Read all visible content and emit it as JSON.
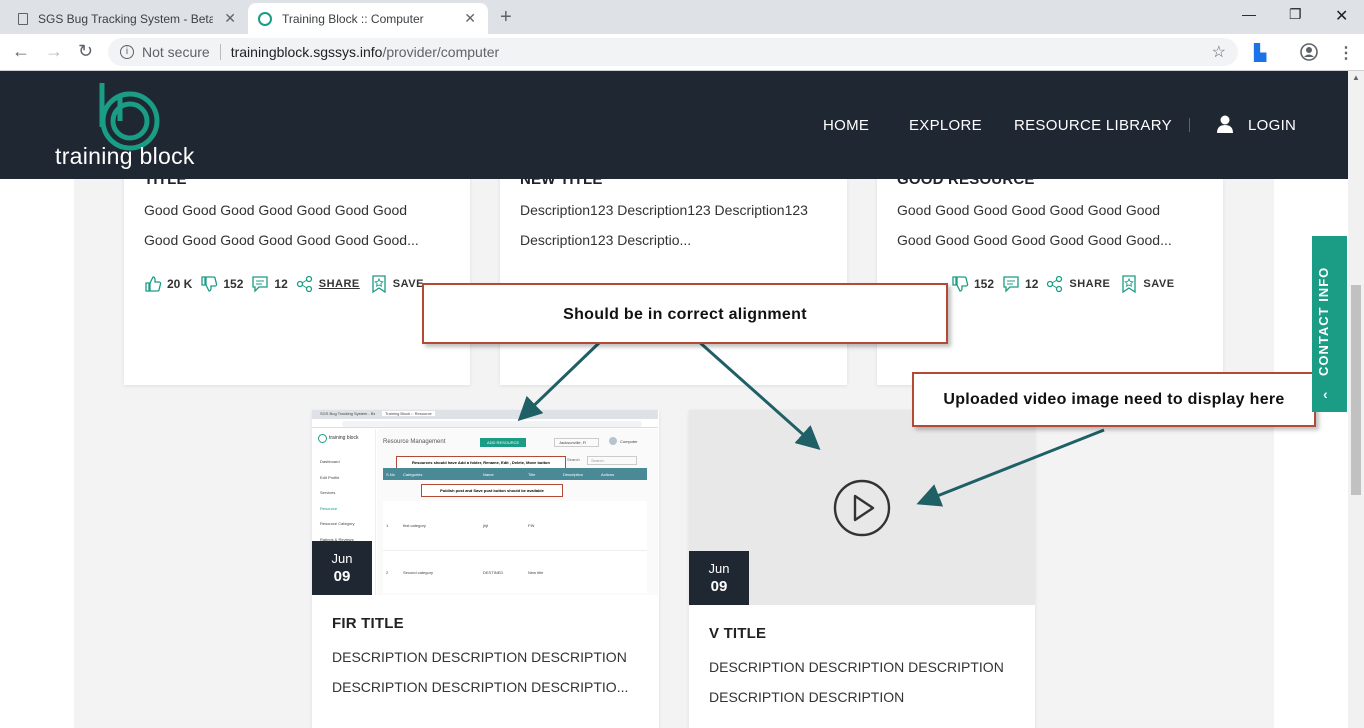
{
  "browser": {
    "tabs": [
      {
        "title": "SGS Bug Tracking System - Beta V"
      },
      {
        "title": "Training Block :: Computer"
      }
    ],
    "security": "Not secure",
    "url_host": "trainingblock.sgssys.info",
    "url_path": "/provider/computer"
  },
  "site": {
    "logo_text": "training block",
    "nav": [
      "HOME",
      "EXPLORE",
      "RESOURCE LIBRARY"
    ],
    "login": "LOGIN"
  },
  "cards_top": [
    {
      "title": "TITLE",
      "description": [
        "Good Good Good Good Good Good Good",
        "Good Good Good Good Good Good Good..."
      ],
      "likes": "20 K",
      "dislikes": "152",
      "comments": "12",
      "share": "SHARE",
      "save": "SAVE"
    },
    {
      "title": "NEW TITLE",
      "description": [
        "Description123 Description123 Description123",
        "Description123 Descriptio..."
      ]
    },
    {
      "title": "GOOD RESOURCE",
      "description": [
        "Good Good Good Good Good Good Good",
        "Good Good Good Good Good Good Good..."
      ],
      "dislikes": "152",
      "comments": "12",
      "share": "SHARE",
      "save": "SAVE"
    }
  ],
  "cards_bottom": [
    {
      "month": "Jun",
      "day": "09",
      "title": "FIR TITLE",
      "description": [
        "DESCRIPTION DESCRIPTION DESCRIPTION",
        "DESCRIPTION DESCRIPTION DESCRIPTIO..."
      ],
      "thumb": {
        "tab1": "SGS Bug Tracking System - Beta",
        "tab2": "Training Block :: Resource",
        "logo": "training block",
        "heading": "Resource Management",
        "add_btn": "ADD RESOURCE",
        "location": "Jacksonville, Fl",
        "user": "Computer",
        "menu": [
          "Dashboard",
          "Edit Profile",
          "Services",
          "Resource",
          "Resource Category",
          "Ratings & Reviews"
        ],
        "note1": "Resources should have Add a folder, Rename, Edit , Delete, Move button",
        "note2": "Publish post and Save post button should be available",
        "columns": [
          "S.No",
          "Categories",
          "Name",
          "Title",
          "Description",
          "Actions"
        ],
        "search_label": "Search",
        "search_placeholder": "Search",
        "rows": [
          {
            "no": "1",
            "category": "first category",
            "name": "jhjt",
            "title": "FIN"
          },
          {
            "no": "2",
            "category": "Second category",
            "name": "DESTINED",
            "title": "New title"
          }
        ]
      }
    },
    {
      "month": "Jun",
      "day": "09",
      "title": "V TITLE",
      "description": [
        "DESCRIPTION DESCRIPTION DESCRIPTION",
        "DESCRIPTION DESCRIPTION"
      ]
    }
  ],
  "annotations": {
    "alignment": "Should be in correct alignment",
    "video": "Uploaded video image need to display here"
  },
  "contact_tab": "CONTACT INFO",
  "colors": {
    "header_bg": "#1f2733",
    "accent": "#1a9c85",
    "callout_border": "#b34a35",
    "arrow": "#1f5f66"
  }
}
